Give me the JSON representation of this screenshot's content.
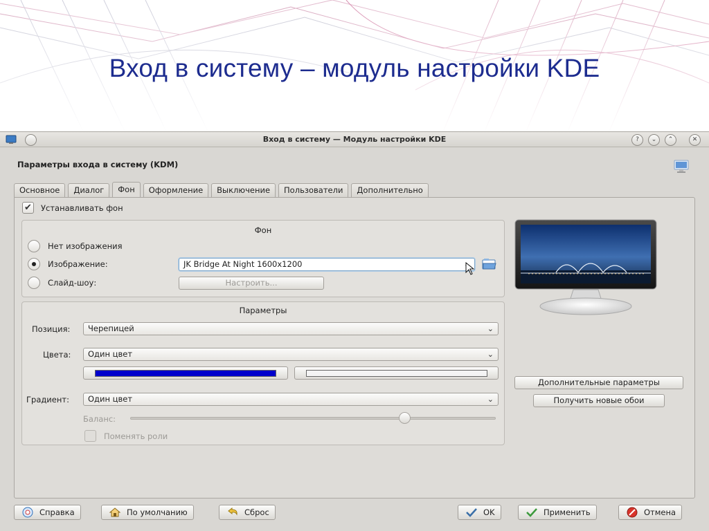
{
  "slide": {
    "title": "Вход в систему – модуль настройки KDE"
  },
  "window": {
    "title": "Вход в систему — Модуль настройки KDE",
    "buttons": {
      "help": "?",
      "minimize": "⌄",
      "maximize": "⌃",
      "close": "✕"
    }
  },
  "module": {
    "header": "Параметры входа в систему (KDM)"
  },
  "tabs": [
    {
      "label": "Основное"
    },
    {
      "label": "Диалог"
    },
    {
      "label": "Фон"
    },
    {
      "label": "Оформление"
    },
    {
      "label": "Выключение"
    },
    {
      "label": "Пользователи"
    },
    {
      "label": "Дополнительно"
    }
  ],
  "active_tab": "Фон",
  "background": {
    "set_background_label": "Устанавливать фон",
    "set_background_checked": true,
    "group_title": "Фон",
    "no_image_label": "Нет изображения",
    "image_label": "Изображение:",
    "slideshow_label": "Слайд-шоу:",
    "selected_mode": "image",
    "image_value": "JK Bridge At Night 1600x1200",
    "configure_label": "Настроить..."
  },
  "params": {
    "group_title": "Параметры",
    "position_label": "Позиция:",
    "position_value": "Черепицей",
    "colors_label": "Цвета:",
    "colors_value": "Один цвет",
    "primary_color": "#0000cc",
    "secondary_color": "#f4f4f4",
    "gradient_label": "Градиент:",
    "gradient_value": "Один цвет",
    "balance_label": "Баланс:",
    "balance_value": 0.75,
    "swap_roles_label": "Поменять роли"
  },
  "side": {
    "advanced_label": "Дополнительные параметры",
    "get_new_label": "Получить новые обои"
  },
  "footer": {
    "help": "Справка",
    "defaults": "По умолчанию",
    "reset": "Сброс",
    "ok": "OK",
    "apply": "Применить",
    "cancel": "Отмена"
  },
  "icons": {
    "window": "kde-window-icon",
    "module": "monitor-icon",
    "file_open": "folder-open-icon",
    "help": "help-icon",
    "defaults": "defaults-icon",
    "reset": "undo-icon",
    "ok": "checkmark-icon",
    "apply": "apply-icon",
    "cancel": "cancel-icon"
  }
}
